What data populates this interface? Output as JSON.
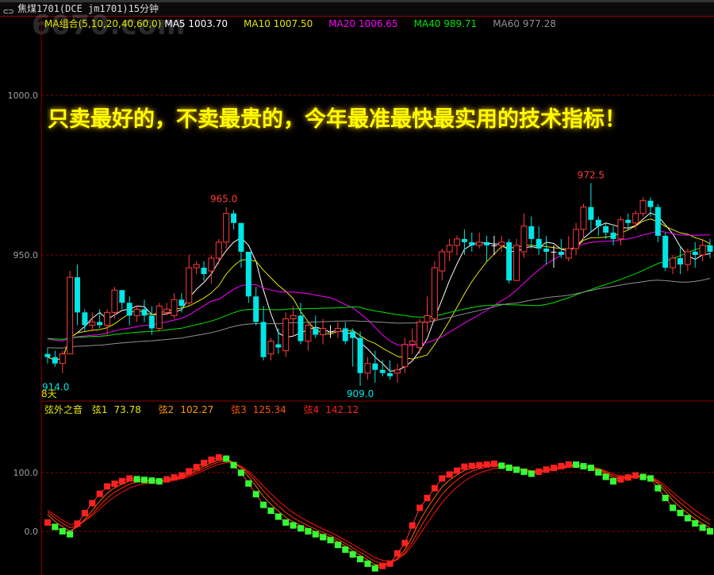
{
  "window": {
    "title": "焦煤1701(DCE jm1701)15分钟",
    "icon": "link-icon"
  },
  "watermark": "6070.com",
  "banner": "只卖最好的，不卖最贵的，今年最准最快最实用的技术指标！",
  "ma_legend": {
    "name": "MA组合(5,10,20,40,60,0)",
    "items": [
      {
        "label": "MA5 1003.70",
        "color": "#ffffff",
        "period": 5
      },
      {
        "label": "MA10 1007.50",
        "color": "#e6e600",
        "period": 10
      },
      {
        "label": "MA20 1006.65",
        "color": "#ff00ff",
        "period": 20
      },
      {
        "label": "MA40 989.71",
        "color": "#00e600",
        "period": 40
      },
      {
        "label": "MA60 977.28",
        "color": "#909090",
        "period": 60
      }
    ]
  },
  "indicator_legend": {
    "name": "弦外之音",
    "items": [
      {
        "label": "弦1",
        "value": "73.78",
        "color": "#e6e600"
      },
      {
        "label": "弦2",
        "value": "102.27",
        "color": "#ff9900"
      },
      {
        "label": "弦3",
        "value": "125.34",
        "color": "#ff5500"
      },
      {
        "label": "弦4",
        "value": "142.12",
        "color": "#ff2020"
      }
    ]
  },
  "colors": {
    "up": "#ff3b3b",
    "down": "#00e5e5",
    "grid": "#8b0000",
    "axis_text": "#a0a0a0"
  },
  "period_label": "8天",
  "chart_data": [
    {
      "type": "candlestick",
      "ylim": [
        903,
        1008
      ],
      "yticks": [
        {
          "value": 1000,
          "label": "1000.0"
        },
        {
          "value": 950,
          "label": "950.0"
        }
      ],
      "annotations": {
        "high1": "965.0",
        "high2": "972.5",
        "low1": "914.0",
        "low2": "909.0"
      },
      "candles": [
        [
          919,
          921,
          916,
          918
        ],
        [
          918,
          920,
          915,
          916
        ],
        [
          916,
          920,
          913,
          919
        ],
        [
          919,
          945,
          919,
          943
        ],
        [
          943,
          947,
          928,
          932
        ],
        [
          932,
          933,
          926,
          928
        ],
        [
          928,
          932,
          926,
          929
        ],
        [
          929,
          933,
          927,
          928
        ],
        [
          928,
          933,
          925,
          932
        ],
        [
          932,
          940,
          930,
          939
        ],
        [
          939,
          939,
          933,
          935
        ],
        [
          935,
          937,
          928,
          931
        ],
        [
          931,
          934,
          929,
          933
        ],
        [
          933,
          936,
          929,
          931
        ],
        [
          931,
          934,
          925,
          927
        ],
        [
          927,
          935,
          926,
          934
        ],
        [
          932,
          935,
          931,
          933
        ],
        [
          931,
          938,
          930,
          936
        ],
        [
          936,
          938,
          932,
          934
        ],
        [
          935,
          950,
          934,
          946
        ],
        [
          946,
          948,
          944,
          947
        ],
        [
          946,
          948,
          942,
          944
        ],
        [
          945,
          950,
          941,
          949
        ],
        [
          949,
          955,
          947,
          954
        ],
        [
          954,
          965,
          952,
          963
        ],
        [
          963,
          964,
          958,
          960
        ],
        [
          960,
          960,
          946,
          951
        ],
        [
          951,
          951,
          935,
          937
        ],
        [
          937,
          940,
          928,
          929
        ],
        [
          929,
          934,
          917,
          918
        ],
        [
          919,
          924,
          917,
          923
        ],
        [
          922,
          927,
          919,
          921
        ],
        [
          920,
          932,
          918,
          930
        ],
        [
          930,
          934,
          925,
          931
        ],
        [
          931,
          935,
          922,
          923
        ],
        [
          923,
          929,
          920,
          928
        ],
        [
          927,
          931,
          924,
          925
        ],
        [
          925,
          930,
          922,
          927
        ],
        [
          926,
          928,
          924,
          926
        ],
        [
          926,
          929,
          924,
          927
        ],
        [
          927,
          929,
          922,
          923
        ],
        [
          926,
          927,
          915,
          924
        ],
        [
          924,
          926,
          909,
          913
        ],
        [
          913,
          918,
          911,
          916
        ],
        [
          916,
          920,
          910,
          914
        ],
        [
          914,
          917,
          912,
          913
        ],
        [
          913,
          917,
          911,
          912
        ],
        [
          913,
          916,
          910,
          914
        ],
        [
          915,
          924,
          913,
          922
        ],
        [
          922,
          927,
          919,
          923
        ],
        [
          921,
          930,
          919,
          929
        ],
        [
          929,
          937,
          926,
          931
        ],
        [
          930,
          948,
          929,
          946
        ],
        [
          945,
          952,
          942,
          951
        ],
        [
          951,
          955,
          948,
          953
        ],
        [
          953,
          956,
          950,
          955
        ],
        [
          955,
          958,
          950,
          954
        ],
        [
          954,
          957,
          951,
          953
        ],
        [
          953,
          957,
          952,
          954
        ],
        [
          954,
          956,
          948,
          953
        ],
        [
          953,
          956,
          950,
          953
        ],
        [
          953,
          956,
          951,
          954
        ],
        [
          954,
          955,
          941,
          942
        ],
        [
          942,
          955,
          942,
          953
        ],
        [
          951,
          963,
          949,
          959
        ],
        [
          959,
          962,
          952,
          955
        ],
        [
          955,
          959,
          950,
          952
        ],
        [
          952,
          956,
          947,
          951
        ],
        [
          951,
          953,
          946,
          951
        ],
        [
          951,
          955,
          949,
          950
        ],
        [
          949,
          956,
          948,
          952
        ],
        [
          952,
          960,
          950,
          958
        ],
        [
          958,
          966,
          955,
          965
        ],
        [
          965,
          972.5,
          957,
          961
        ],
        [
          961,
          962,
          956,
          959
        ],
        [
          959,
          960,
          955,
          957
        ],
        [
          957,
          959,
          953,
          955
        ],
        [
          955,
          962,
          953,
          961
        ],
        [
          961,
          963,
          958,
          960
        ],
        [
          960,
          964,
          958,
          963
        ],
        [
          963,
          968,
          962,
          967
        ],
        [
          967,
          968,
          962,
          965
        ],
        [
          965,
          966,
          954,
          956
        ],
        [
          956,
          957,
          945,
          946
        ],
        [
          946,
          950,
          944,
          949
        ],
        [
          949,
          953,
          944,
          947
        ],
        [
          947,
          952,
          945,
          951
        ],
        [
          951,
          954,
          946,
          950
        ],
        [
          950,
          955,
          948,
          953
        ],
        [
          953,
          955,
          949,
          951
        ]
      ]
    },
    {
      "type": "line",
      "name": "弦外之音",
      "ylim": [
        -75,
        170
      ],
      "yticks": [
        {
          "value": 100,
          "label": "100.0"
        },
        {
          "value": 0,
          "label": "0.0"
        }
      ],
      "line1_keypoints": [
        [
          0,
          15
        ],
        [
          2,
          0
        ],
        [
          3,
          -5
        ],
        [
          5.5,
          40
        ],
        [
          7.7,
          75
        ],
        [
          11,
          90
        ],
        [
          15,
          85
        ],
        [
          18,
          95
        ],
        [
          21.5,
          120
        ],
        [
          23.6,
          128
        ],
        [
          25.7,
          105
        ],
        [
          29,
          45
        ],
        [
          32,
          15
        ],
        [
          35,
          0
        ],
        [
          38,
          -15
        ],
        [
          41.7,
          -45
        ],
        [
          44,
          -63
        ],
        [
          46,
          -55
        ],
        [
          48,
          -20
        ],
        [
          50,
          40
        ],
        [
          53,
          90
        ],
        [
          56,
          110
        ],
        [
          60,
          115
        ],
        [
          65,
          98
        ],
        [
          67,
          105
        ],
        [
          70.4,
          115
        ],
        [
          73,
          108
        ],
        [
          76,
          85
        ],
        [
          79,
          95
        ],
        [
          81,
          90
        ],
        [
          84,
          40
        ],
        [
          87.4,
          10
        ],
        [
          89,
          0
        ]
      ]
    }
  ]
}
